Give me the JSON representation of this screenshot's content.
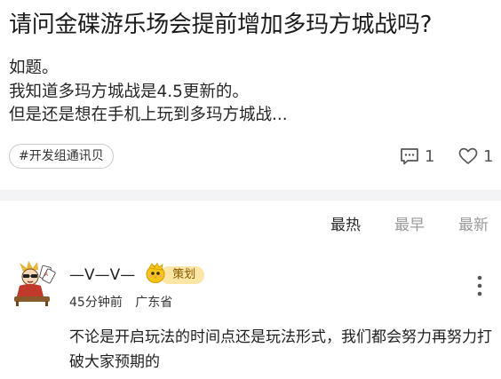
{
  "post": {
    "title": "请问金碟游乐场会提前增加多玛方城战吗?",
    "body_lines": [
      "如题。",
      "我知道多玛方城战是4.5更新的。",
      "但是还是想在手机上玩到多玛方城战..."
    ],
    "tag": "#开发组通讯贝",
    "comment_count": "1",
    "like_count": "1"
  },
  "sort_tabs": [
    "最热",
    "最早",
    "最新"
  ],
  "comment": {
    "author": "—V—V—",
    "role_badge": "策划",
    "time": "45分钟前",
    "location": "广东省",
    "text": "不论是开启玩法的时间点还是玩法形式，我们都会努力再努力打破大家预期的"
  },
  "icons": {
    "comment": "comment-bubble-icon",
    "like": "heart-outline-icon",
    "more": "more-vertical-icon",
    "badge": "bird-mascot-icon"
  },
  "colors": {
    "badge_bg": "#fbe6a6",
    "badge_text": "#8a5a00",
    "divider": "#f3f4f6",
    "muted": "#9a9a9a"
  }
}
